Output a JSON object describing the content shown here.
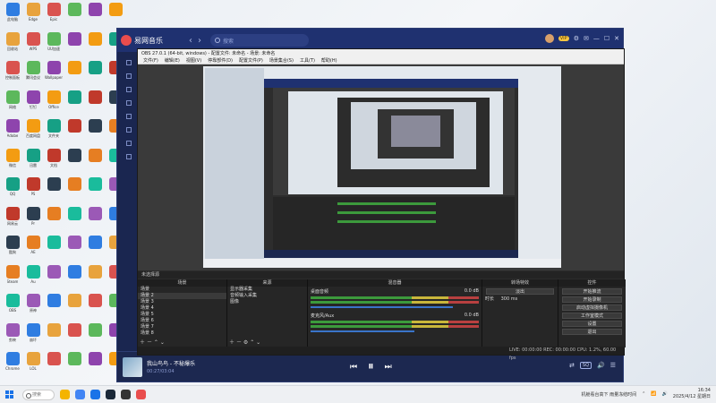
{
  "desktop": {
    "icons": [
      "此电脑",
      "回收站",
      "控制面板",
      "网络",
      "Adobe",
      "微信",
      "QQ",
      "网易云",
      "酷狗",
      "Steam",
      "OBS",
      "剪映",
      "Chrome",
      "Edge",
      "WPS",
      "腾讯会议",
      "钉钉",
      "百度网盘",
      "迅雷",
      "PS",
      "Pr",
      "AE",
      "Au",
      "原神",
      "崩坏",
      "LOL",
      "Epic",
      "UU加速",
      "Wallpaper",
      "Office",
      "文件夹",
      "文档"
    ]
  },
  "music": {
    "app_name": "易网音乐",
    "search_placeholder": "搜索",
    "vip": "VIP",
    "nav_back": "‹",
    "nav_fwd": "›",
    "song_title": "我山鸟鸟 - 不秘爆乐",
    "song_time": "00:27/03:04",
    "prev": "⏮",
    "play": "⏸",
    "next": "⏭",
    "quality": "SQ",
    "volume": "🔊"
  },
  "obs": {
    "title": "OBS 27.0.1 (64-bit, windows) - 配置文件: 未命名 - 场景: 未命名",
    "menu": [
      "文件(F)",
      "编辑(E)",
      "视图(V)",
      "停靠部件(D)",
      "配置文件(P)",
      "场景集合(S)",
      "工具(T)",
      "帮助(H)"
    ],
    "source_bar": "未选择源",
    "docks": {
      "scenes_title": "场景",
      "scenes": [
        "场景",
        "场景 2",
        "场景 3",
        "场景 4",
        "场景 5",
        "场景 6",
        "场景 7",
        "场景 8"
      ],
      "sources_title": "来源",
      "sources": [
        "显示器采集",
        "音频输入采集",
        "图像"
      ],
      "mixer_title": "混音器",
      "mixer": [
        {
          "name": "桌面音频",
          "db": "0.0 dB",
          "level": 0.82
        },
        {
          "name": "麦克风/Aux",
          "db": "0.0 dB",
          "level": 0.6
        }
      ],
      "transitions_title": "转场特效",
      "transition": "淡出",
      "duration_label": "时长",
      "duration": "300 ms",
      "controls_title": "控件",
      "controls": [
        "开始推流",
        "开始录制",
        "启动虚拟摄像机",
        "工作室模式",
        "设置",
        "退出"
      ]
    },
    "status": "LIVE: 00:00:00  REC: 00:00:00  CPU: 1.2%, 60.00 fps"
  },
  "taskbar": {
    "search": "搜索",
    "weather": "机舱看台高下 雨量冻结时间",
    "time": "16:34",
    "date": "2025/4/12 星期日"
  }
}
